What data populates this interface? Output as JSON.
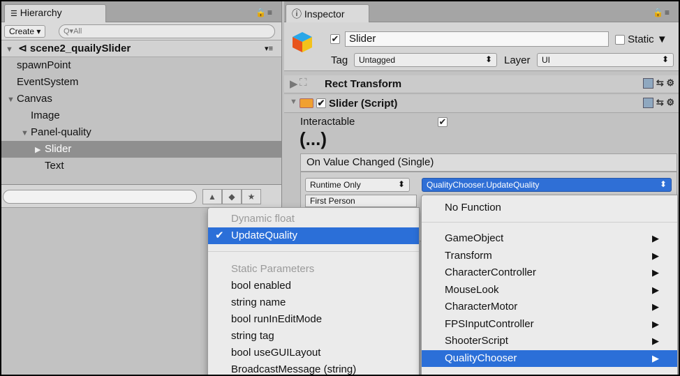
{
  "hierarchy": {
    "tab_label": "Hierarchy",
    "create_label": "Create",
    "search_placeholder": "Q▾All",
    "scene_name": "scene2_quailySlider",
    "items": [
      {
        "label": "spawnPoint",
        "indent": 1,
        "expand": ""
      },
      {
        "label": "EventSystem",
        "indent": 1,
        "expand": ""
      },
      {
        "label": "Canvas",
        "indent": 1,
        "expand": "▼"
      },
      {
        "label": "Image",
        "indent": 2,
        "expand": ""
      },
      {
        "label": "Panel-quality",
        "indent": 2,
        "expand": "▼"
      },
      {
        "label": "Slider",
        "indent": 3,
        "expand": "▶",
        "selected": true
      },
      {
        "label": "Text",
        "indent": 3,
        "expand": ""
      }
    ]
  },
  "inspector": {
    "tab_label": "Inspector",
    "object_name": "Slider",
    "static_label": "Static",
    "tag_label": "Tag",
    "tag_value": "Untagged",
    "layer_label": "Layer",
    "layer_value": "UI",
    "rect_transform_label": "Rect Transform",
    "slider_component_label": "Slider (Script)",
    "interactable_label": "Interactable",
    "ellipsis": "(...)",
    "event_header": "On Value Changed (Single)",
    "runtime_option": "Runtime Only",
    "function_value": "QualityChooser.UpdateQuality",
    "object_field": "First Person"
  },
  "left_menu": {
    "header_dynamic": "Dynamic float",
    "active_item": "UpdateQuality",
    "header_static": "Static Parameters",
    "items": [
      "bool enabled",
      "string name",
      "bool runInEditMode",
      "string tag",
      "bool useGUILayout",
      "BroadcastMessage (string)"
    ]
  },
  "right_menu": {
    "no_function": "No Function",
    "items": [
      "GameObject",
      "Transform",
      "CharacterController",
      "MouseLook",
      "CharacterMotor",
      "FPSInputController",
      "ShooterScript",
      "QualityChooser"
    ]
  },
  "colors": {
    "selection_blue": "#2b6fd8",
    "panel_gray": "#c2c2c2"
  }
}
